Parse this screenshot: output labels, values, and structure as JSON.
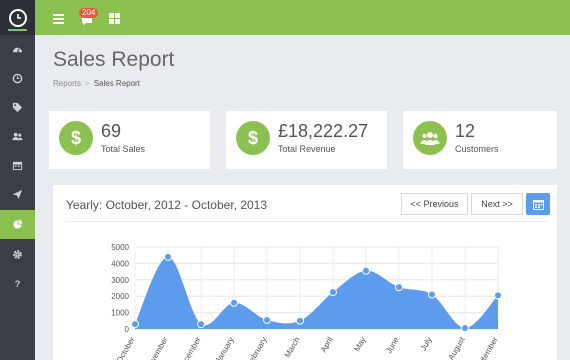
{
  "topbar": {
    "notification_count": "204"
  },
  "page": {
    "title": "Sales Report"
  },
  "breadcrumb": {
    "parent": "Reports",
    "separator": ">",
    "current": "Sales Report"
  },
  "stats": [
    {
      "icon": "dollar-icon",
      "glyph": "$",
      "value": "69",
      "label": "Total Sales"
    },
    {
      "icon": "dollar-icon",
      "glyph": "$",
      "value": "£18,222.27",
      "label": "Total Revenue"
    },
    {
      "icon": "users-icon",
      "glyph": "",
      "value": "12",
      "label": "Customers"
    }
  ],
  "panel": {
    "title": "Yearly: October, 2012 - October, 2013",
    "prev_label": "<< Previous",
    "next_label": "Next >>"
  },
  "chart_data": {
    "type": "area",
    "categories": [
      "October",
      "November",
      "December",
      "January",
      "February",
      "March",
      "April",
      "May",
      "June",
      "July",
      "August",
      "September"
    ],
    "values": [
      300,
      4400,
      300,
      1600,
      550,
      500,
      2250,
      3550,
      2550,
      2100,
      50,
      2050
    ],
    "ylim": [
      0,
      5000
    ],
    "yticks": [
      "0",
      "1000",
      "2000",
      "3000",
      "4000",
      "5000"
    ],
    "grid": true,
    "color": "#5d9cec"
  },
  "colors": {
    "accent": "#8cc152",
    "chart": "#5d9cec",
    "sidebar": "#3a3f47"
  }
}
